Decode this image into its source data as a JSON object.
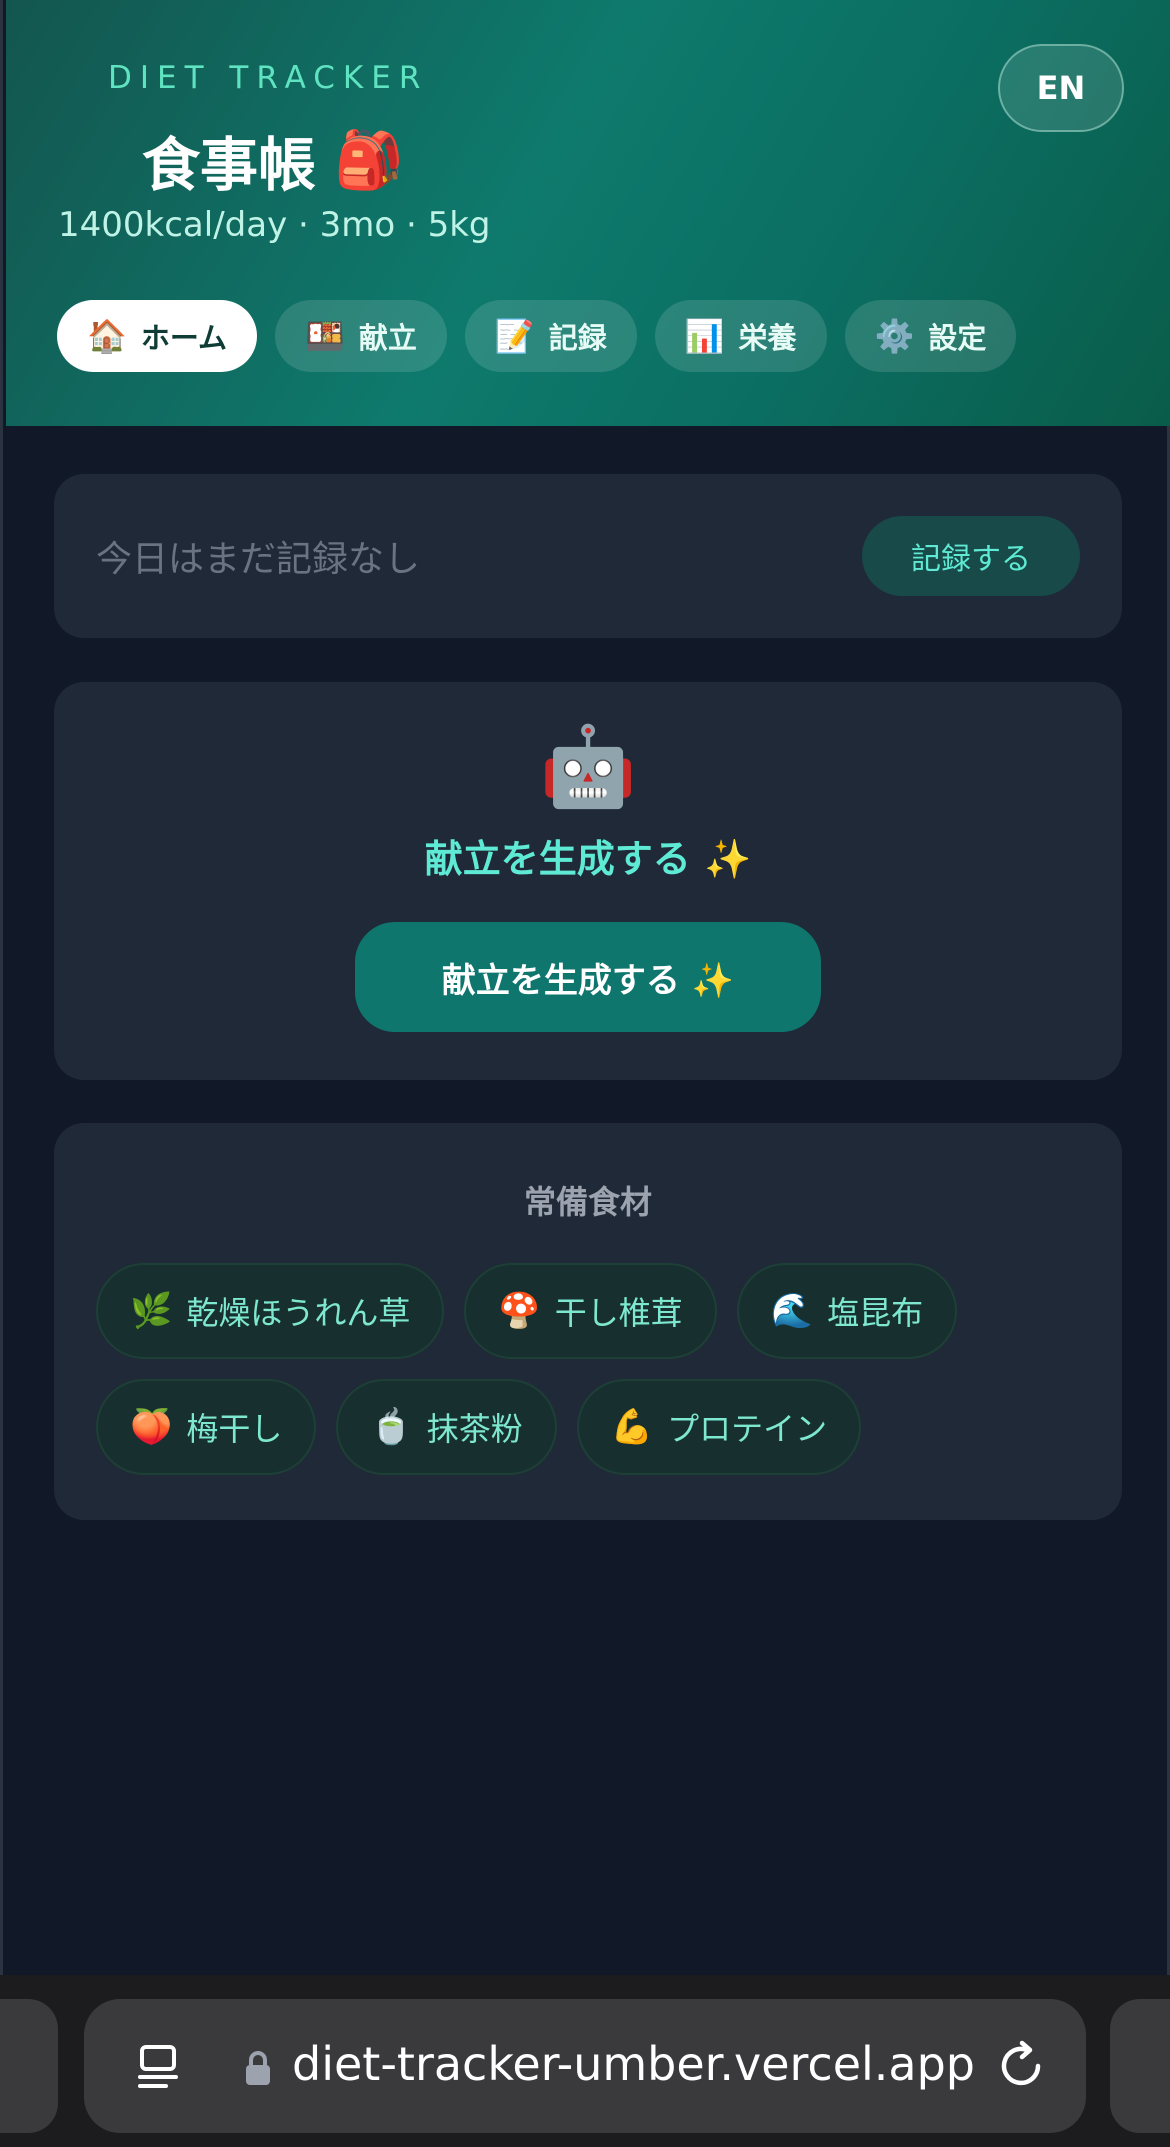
{
  "header": {
    "brand_sub": "DIET TRACKER",
    "title": "食事帳",
    "title_emoji": "🎒",
    "meta": "1400kcal/day · 3mo · 5kg",
    "lang_label": "EN"
  },
  "nav": {
    "tabs": [
      {
        "emoji": "🏠",
        "label": "ホーム",
        "active": true
      },
      {
        "emoji": "🍱",
        "label": "献立",
        "active": false
      },
      {
        "emoji": "📝",
        "label": "記録",
        "active": false
      },
      {
        "emoji": "📊",
        "label": "栄養",
        "active": false
      },
      {
        "emoji": "⚙️",
        "label": "設定",
        "active": false
      }
    ]
  },
  "status_card": {
    "text": "今日はまだ記録なし",
    "button_label": "記録する"
  },
  "ai_card": {
    "icon": "🤖",
    "title": "献立を生成する ✨",
    "button_label": "献立を生成する ✨"
  },
  "pantry": {
    "title": "常備食材",
    "items": [
      {
        "emoji": "🌿",
        "label": "乾燥ほうれん草"
      },
      {
        "emoji": "🍄",
        "label": "干し椎茸"
      },
      {
        "emoji": "🌊",
        "label": "塩昆布"
      },
      {
        "emoji": "🍑",
        "label": "梅干し"
      },
      {
        "emoji": "🍵",
        "label": "抹茶粉"
      },
      {
        "emoji": "💪",
        "label": "プロテイン"
      }
    ]
  },
  "browser": {
    "url": "diet-tracker-umber.vercel.app"
  },
  "colors": {
    "accent": "#5eead4",
    "primary_button": "#0f766e",
    "background": "#111827",
    "card": "#1f2937"
  }
}
